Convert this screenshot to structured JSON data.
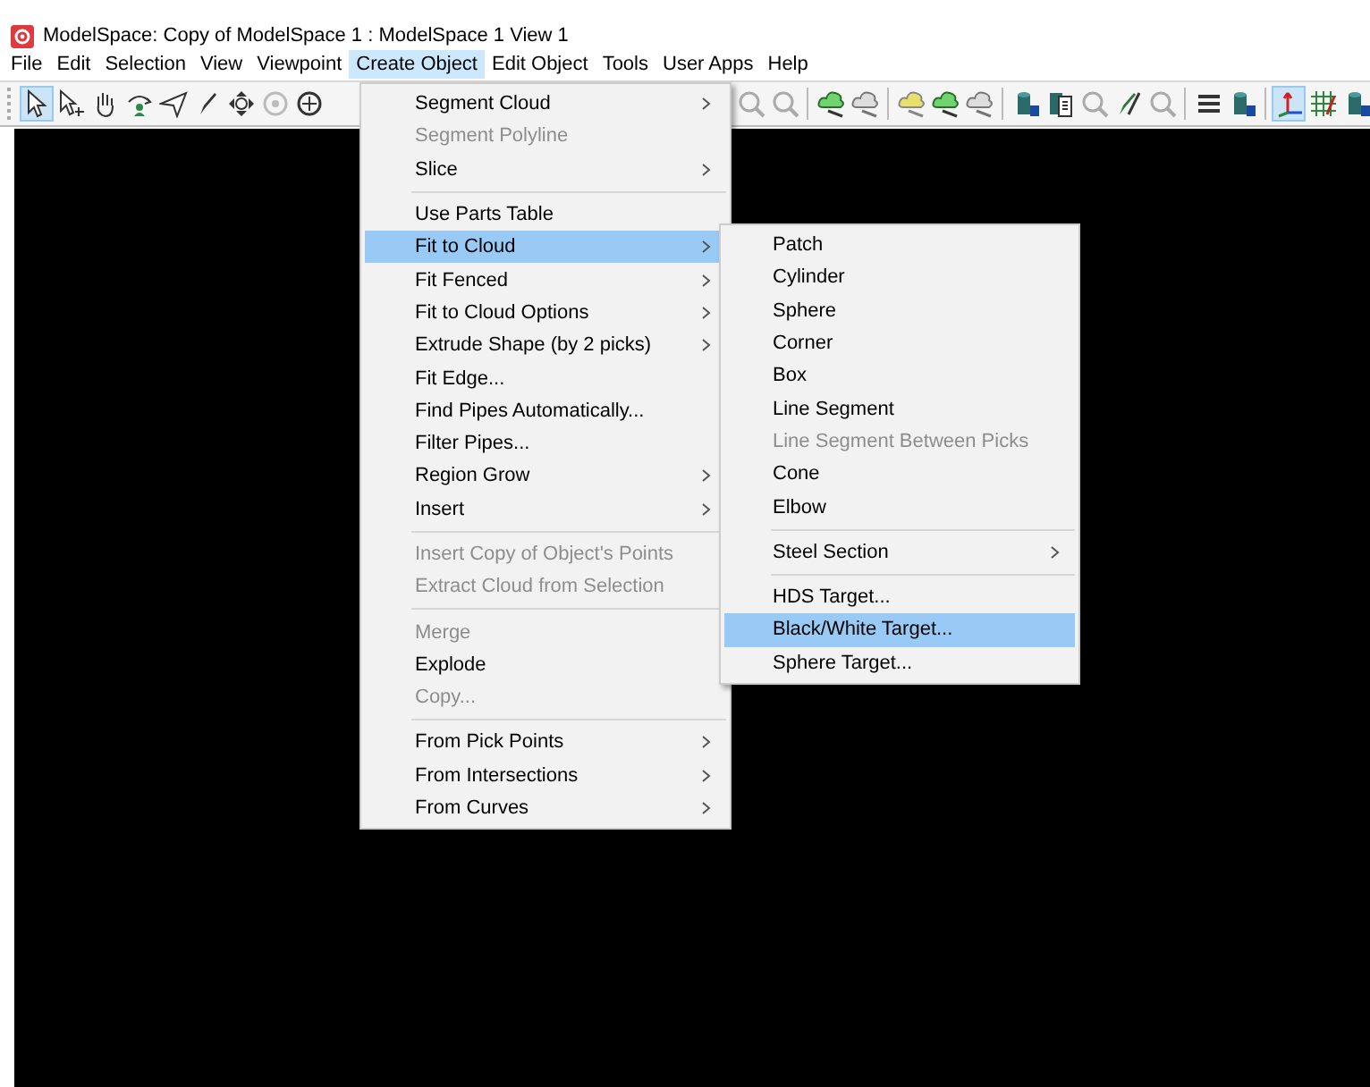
{
  "window": {
    "title": "ModelSpace: Copy of ModelSpace 1 : ModelSpace 1 View 1"
  },
  "menu_bar": [
    {
      "label": "File",
      "selected": false
    },
    {
      "label": "Edit",
      "selected": false
    },
    {
      "label": "Selection",
      "selected": false
    },
    {
      "label": "View",
      "selected": false
    },
    {
      "label": "Viewpoint",
      "selected": false
    },
    {
      "label": "Create Object",
      "selected": true
    },
    {
      "label": "Edit Object",
      "selected": false
    },
    {
      "label": "Tools",
      "selected": false
    },
    {
      "label": "User Apps",
      "selected": false
    },
    {
      "label": "Help",
      "selected": false
    }
  ],
  "toolbar_left": [
    {
      "kind": "pointer",
      "selected": true
    },
    {
      "kind": "pointer-plus",
      "selected": false
    },
    {
      "kind": "hand",
      "selected": false
    },
    {
      "kind": "orbit",
      "selected": false
    },
    {
      "kind": "plane",
      "selected": false
    },
    {
      "kind": "pencil",
      "selected": false
    },
    {
      "kind": "move",
      "selected": false
    },
    {
      "kind": "target-faded",
      "selected": false
    },
    {
      "kind": "target",
      "selected": false
    }
  ],
  "toolbar_right": [
    {
      "kind": "zoom-faded",
      "selected": false
    },
    {
      "kind": "zoom-faded",
      "selected": false
    },
    {
      "kind": "sep"
    },
    {
      "kind": "cloud-green",
      "selected": false
    },
    {
      "kind": "cloud-grey",
      "selected": false
    },
    {
      "kind": "sep"
    },
    {
      "kind": "cloud-yellow",
      "selected": false
    },
    {
      "kind": "cloud-green",
      "selected": false
    },
    {
      "kind": "cloud-grey",
      "selected": false
    },
    {
      "kind": "sep"
    },
    {
      "kind": "cylinder",
      "selected": false
    },
    {
      "kind": "document",
      "selected": false
    },
    {
      "kind": "zoom-faded",
      "selected": false
    },
    {
      "kind": "pencil-green",
      "selected": false
    },
    {
      "kind": "zoom-faded",
      "selected": false
    },
    {
      "kind": "sep"
    },
    {
      "kind": "layers",
      "selected": false
    },
    {
      "kind": "cylinder",
      "selected": false
    },
    {
      "kind": "sep"
    },
    {
      "kind": "axes",
      "selected": true
    },
    {
      "kind": "grid",
      "selected": false
    },
    {
      "kind": "cylinder",
      "selected": false
    }
  ],
  "menu": [
    {
      "kind": "item",
      "label": "Segment Cloud",
      "disabled": false,
      "submenu": true,
      "selected": false
    },
    {
      "kind": "item",
      "label": "Segment Polyline",
      "disabled": true,
      "submenu": false,
      "selected": false
    },
    {
      "kind": "item",
      "label": "Slice",
      "disabled": false,
      "submenu": true,
      "selected": false
    },
    {
      "kind": "separator"
    },
    {
      "kind": "item",
      "label": "Use Parts Table",
      "disabled": false,
      "submenu": false,
      "selected": false
    },
    {
      "kind": "item",
      "label": "Fit to Cloud",
      "disabled": false,
      "submenu": true,
      "selected": true
    },
    {
      "kind": "item",
      "label": "Fit Fenced",
      "disabled": false,
      "submenu": true,
      "selected": false
    },
    {
      "kind": "item",
      "label": "Fit to Cloud Options",
      "disabled": false,
      "submenu": true,
      "selected": false
    },
    {
      "kind": "item",
      "label": "Extrude Shape (by 2 picks)",
      "disabled": false,
      "submenu": true,
      "selected": false
    },
    {
      "kind": "item",
      "label": "Fit Edge...",
      "disabled": false,
      "submenu": false,
      "selected": false
    },
    {
      "kind": "item",
      "label": "Find Pipes Automatically...",
      "disabled": false,
      "submenu": false,
      "selected": false
    },
    {
      "kind": "item",
      "label": "Filter Pipes...",
      "disabled": false,
      "submenu": false,
      "selected": false
    },
    {
      "kind": "item",
      "label": "Region Grow",
      "disabled": false,
      "submenu": true,
      "selected": false
    },
    {
      "kind": "item",
      "label": "Insert",
      "disabled": false,
      "submenu": true,
      "selected": false
    },
    {
      "kind": "separator"
    },
    {
      "kind": "item",
      "label": "Insert Copy of Object's Points",
      "disabled": true,
      "submenu": false,
      "selected": false
    },
    {
      "kind": "item",
      "label": "Extract Cloud from Selection",
      "disabled": true,
      "submenu": false,
      "selected": false
    },
    {
      "kind": "separator"
    },
    {
      "kind": "item",
      "label": "Merge",
      "disabled": true,
      "submenu": false,
      "selected": false
    },
    {
      "kind": "item",
      "label": "Explode",
      "disabled": false,
      "submenu": false,
      "selected": false
    },
    {
      "kind": "item",
      "label": "Copy...",
      "disabled": true,
      "submenu": false,
      "selected": false
    },
    {
      "kind": "separator"
    },
    {
      "kind": "item",
      "label": "From Pick Points",
      "disabled": false,
      "submenu": true,
      "selected": false
    },
    {
      "kind": "item",
      "label": "From Intersections",
      "disabled": false,
      "submenu": true,
      "selected": false
    },
    {
      "kind": "item",
      "label": "From Curves",
      "disabled": false,
      "submenu": true,
      "selected": false
    }
  ],
  "submenu": [
    {
      "kind": "item",
      "label": "Patch",
      "disabled": false,
      "submenu": false,
      "selected": false
    },
    {
      "kind": "item",
      "label": "Cylinder",
      "disabled": false,
      "submenu": false,
      "selected": false
    },
    {
      "kind": "item",
      "label": "Sphere",
      "disabled": false,
      "submenu": false,
      "selected": false
    },
    {
      "kind": "item",
      "label": "Corner",
      "disabled": false,
      "submenu": false,
      "selected": false
    },
    {
      "kind": "item",
      "label": "Box",
      "disabled": false,
      "submenu": false,
      "selected": false
    },
    {
      "kind": "item",
      "label": "Line Segment",
      "disabled": false,
      "submenu": false,
      "selected": false
    },
    {
      "kind": "item",
      "label": "Line Segment Between Picks",
      "disabled": true,
      "submenu": false,
      "selected": false
    },
    {
      "kind": "item",
      "label": "Cone",
      "disabled": false,
      "submenu": false,
      "selected": false
    },
    {
      "kind": "item",
      "label": "Elbow",
      "disabled": false,
      "submenu": false,
      "selected": false
    },
    {
      "kind": "separator"
    },
    {
      "kind": "item",
      "label": "Steel Section",
      "disabled": false,
      "submenu": true,
      "selected": false
    },
    {
      "kind": "separator"
    },
    {
      "kind": "item",
      "label": "HDS Target...",
      "disabled": false,
      "submenu": false,
      "selected": false
    },
    {
      "kind": "item",
      "label": "Black/White Target...",
      "disabled": false,
      "submenu": false,
      "selected": true
    },
    {
      "kind": "item",
      "label": "Sphere Target...",
      "disabled": false,
      "submenu": false,
      "selected": false
    }
  ]
}
